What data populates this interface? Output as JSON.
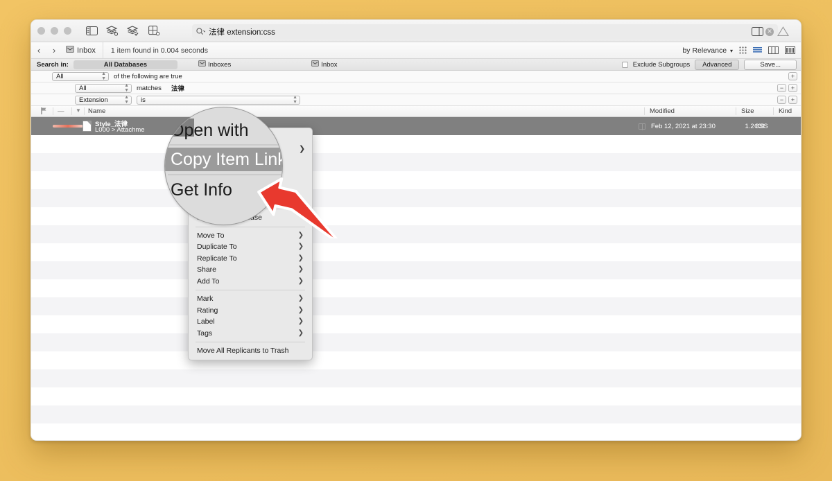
{
  "window": {
    "traffic_lights": [
      "close",
      "minimize",
      "zoom"
    ],
    "toolbar_icons": [
      "sidebar-toggle-icon",
      "databases-icon",
      "inbox-check-icon",
      "page-settings-icon"
    ],
    "right_icons": [
      "inspector-toggle-icon",
      "warning-icon"
    ]
  },
  "search": {
    "query": "法律 extension:css",
    "magnifier_icon": "search-icon",
    "clear_icon": "clear-icon",
    "clear_glyph": "✕"
  },
  "nav": {
    "back_glyph": "‹",
    "forward_glyph": "›",
    "location": "Inbox",
    "location_icon": "inbox-icon",
    "status": "1 item found in 0.004 seconds",
    "sort_label": "by Relevance",
    "sort_caret": "▾",
    "view_icons": [
      "icon-view-icon",
      "list-view-icon",
      "column-view-icon",
      "split-view-icon"
    ]
  },
  "search_in": {
    "label": "Search in:",
    "scopes": [
      {
        "label": "All Databases",
        "active": true,
        "icon": ""
      },
      {
        "label": "Inboxes",
        "active": false,
        "icon": "inboxes-icon"
      },
      {
        "label": "Inbox",
        "active": false,
        "icon": "inbox-icon"
      }
    ],
    "exclude_subgroups": {
      "label": "Exclude Subgroups",
      "checked": false
    },
    "advanced_button": "Advanced",
    "save_button": "Save..."
  },
  "criteria": [
    {
      "popup": "All",
      "text": "of the following are true",
      "indent": false,
      "second_popup": null,
      "value": null,
      "buttons": [
        "+"
      ]
    },
    {
      "popup": "All",
      "text": "matches",
      "indent": true,
      "second_popup": null,
      "value": "法律",
      "buttons": [
        "−",
        "+"
      ]
    },
    {
      "popup": "Extension",
      "text": "",
      "indent": true,
      "second_popup": "is",
      "value": null,
      "buttons": [
        "−",
        "+"
      ]
    }
  ],
  "columns": [
    {
      "label": "",
      "icon": "flag-icon"
    },
    {
      "label": "",
      "icon": "dash-icon"
    },
    {
      "label": "",
      "icon": "chevron-down-icon"
    },
    {
      "label": "Name"
    },
    {
      "label": "Modified"
    },
    {
      "label": "Size"
    },
    {
      "label": "Kind"
    }
  ],
  "result_row": {
    "title": "Style_法律",
    "subtitle": "L000 > Attachme",
    "modified": "Feb 12, 2021 at 23:30",
    "size": "1.2 KB",
    "kind": "CSS",
    "selected": true,
    "doc_icon": "document-icon",
    "relevance_bar": "relevance-bar"
  },
  "empty_row_count": 17,
  "context_menu": {
    "hidden_top_items": [
      {
        "label": "Open with",
        "submenu": true
      },
      {
        "label": "Copy Item Link",
        "submenu": false,
        "highlighted": true
      },
      {
        "label": "Get Info",
        "submenu": false
      },
      {
        "label": "S",
        "submenu": false
      }
    ],
    "items": [
      {
        "label": "Move Into Database",
        "submenu": false
      },
      {
        "separator": true
      },
      {
        "label": "Move To",
        "submenu": true
      },
      {
        "label": "Duplicate To",
        "submenu": true
      },
      {
        "label": "Replicate To",
        "submenu": true
      },
      {
        "label": "Share",
        "submenu": true
      },
      {
        "label": "Add To",
        "submenu": true
      },
      {
        "separator": true
      },
      {
        "label": "Mark",
        "submenu": true
      },
      {
        "label": "Rating",
        "submenu": true
      },
      {
        "label": "Label",
        "submenu": true
      },
      {
        "label": "Tags",
        "submenu": true
      },
      {
        "separator": true
      },
      {
        "label": "Move All Replicants to Trash",
        "submenu": false
      }
    ],
    "chevron_glyph": "❯"
  },
  "magnifier": {
    "item_open_with": "Open with",
    "item_copy_item_link": "Copy Item Link",
    "item_get_info": "Get Info",
    "item_partial": "S",
    "row_fragment": "chme"
  },
  "annotation": {
    "arrow": "red-arrow",
    "arrow_color": "#e8392e",
    "arrow_outline": "#ffffff"
  },
  "colors": {
    "desktop": "#f0c263",
    "selection": "#808080",
    "menu_bg": "#e9e9e9",
    "highlight": "#9b9b9b"
  }
}
